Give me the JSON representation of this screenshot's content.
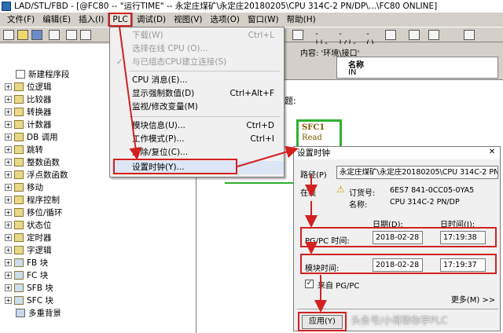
{
  "title_bar": {
    "text": "LAD/STL/FBD  - [@FC80 -- \"运行TIME\" -- 永定庄煤矿\\永定庄20180205\\CPU 314C-2 PN/DP\\...\\FC80  ONLINE]"
  },
  "menu_bar": {
    "items": [
      "文件(F)",
      "编辑(E)",
      "插入(I)",
      "PLC",
      "调试(D)",
      "视图(V)",
      "选项(O)",
      "窗口(W)",
      "帮助(H)"
    ]
  },
  "plc_menu": {
    "items": [
      {
        "label": "下载(W)",
        "shortcut": "Ctrl+L",
        "disabled": true
      },
      {
        "label": "选择在线 CPU (O)...",
        "shortcut": "",
        "disabled": true
      },
      {
        "label": "与已组态CPU建立连接(S)",
        "shortcut": "",
        "disabled": true
      },
      {
        "label": "CPU 消息(E)...",
        "shortcut": "",
        "disabled": false
      },
      {
        "label": "显示强制数值(D)",
        "shortcut": "Ctrl+Alt+F",
        "disabled": false
      },
      {
        "label": "监视/修改变量(M)",
        "shortcut": "",
        "disabled": false
      },
      {
        "label": "模块信息(U)...",
        "shortcut": "Ctrl+D",
        "disabled": false
      },
      {
        "label": "工作模式(P)...",
        "shortcut": "Ctrl+I",
        "disabled": false
      },
      {
        "label": "清除/复位(C)...",
        "shortcut": "",
        "disabled": false
      },
      {
        "label": "设置时钟(Y)...",
        "shortcut": "",
        "disabled": false
      }
    ]
  },
  "tree": {
    "items": [
      "新建程序段",
      "位逻辑",
      "比较器",
      "转换器",
      "计数器",
      "DB 调用",
      "跳转",
      "整数函数",
      "浮点数函数",
      "移动",
      "程序控制",
      "移位/循环",
      "状态位",
      "定时器",
      "字逻辑",
      "FB 块",
      "FC 块",
      "SFB 块",
      "SFC 块",
      "多重背景"
    ]
  },
  "interface": {
    "content_label": "内容: '环境\\接口'",
    "column_name": "名称",
    "row_in": "IN"
  },
  "editor": {
    "title_label": "题:"
  },
  "sfc_block": {
    "name": "SFC1",
    "sub": "Read"
  },
  "dialog": {
    "title": "设置时钟",
    "path_label": "路径(P)",
    "path_value": "永定庄煤矿\\永定庄20180205\\CPU 314C-2 PN/D",
    "online_label": "在线",
    "order_label": "订货号:",
    "order_value": "6ES7 841-0CC05-0YA5",
    "name_label": "名称:",
    "name_value": "CPU 314C-2 PN/DP",
    "date_header": "日期(D):",
    "time_header": "日时间(I):",
    "pgpc_label": "PG/PC 时间:",
    "pgpc_date": "2018-02-28",
    "pgpc_time": "17:19:38",
    "module_label": "模块时间:",
    "module_date": "2018-02-28",
    "module_time": "17:19:37",
    "checkbox_label": "来自 PG/PC",
    "more_button": "更多(M) >>",
    "apply_button": "应用(Y)"
  },
  "watermark": "头条号/小哥聊你学PLC",
  "colors": {
    "highlight": "#d32020",
    "sfc_border": "#2fb02f"
  }
}
